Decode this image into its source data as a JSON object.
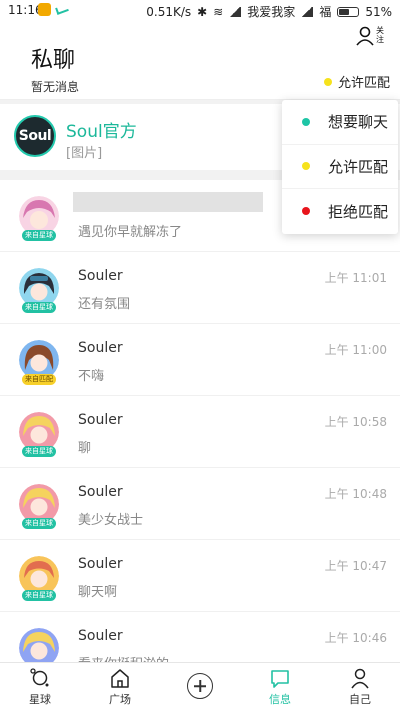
{
  "status_bar": {
    "time": "11:16",
    "speed": "0.51K/s",
    "carrier1": "我爱我家",
    "carrier2": "福",
    "battery": "51%"
  },
  "header": {
    "title": "私聊",
    "subtitle": "暂无消息",
    "follow_label": "关注",
    "match_status": "允许匹配"
  },
  "popup": {
    "items": [
      {
        "label": "想要聊天",
        "color": "#1ec5a6"
      },
      {
        "label": "允许匹配",
        "color": "#f6e21c"
      },
      {
        "label": "拒绝匹配",
        "color": "#e8141c"
      }
    ]
  },
  "official": {
    "logo_text": "Soul",
    "name": "Soul官方",
    "preview": "[图片]"
  },
  "chats": [
    {
      "name": "",
      "preview": "遇见你早就解冻了",
      "time": "",
      "badge": "来自星球",
      "badge_style": "green",
      "face_color": "#f3a7c8",
      "hair_color": "#d877b0"
    },
    {
      "name": "Souler",
      "preview": "还有氛围",
      "time": "上午 11:01",
      "badge": "来自星球",
      "badge_style": "green",
      "face_color": "#8fd6ee",
      "hair_color": "#2a2f3a"
    },
    {
      "name": "Souler",
      "preview": "不嗨",
      "time": "上午 11:00",
      "badge": "来自匹配",
      "badge_style": "yellow",
      "face_color": "#7fb6ef",
      "hair_color": "#8a4a2b"
    },
    {
      "name": "Souler",
      "preview": "聊",
      "time": "上午 10:58",
      "badge": "来自星球",
      "badge_style": "green",
      "face_color": "#f29aa8",
      "hair_color": "#f5d35e"
    },
    {
      "name": "Souler",
      "preview": "美少女战士",
      "time": "上午 10:48",
      "badge": "来自星球",
      "badge_style": "green",
      "face_color": "#f29aa8",
      "hair_color": "#f5d35e"
    },
    {
      "name": "Souler",
      "preview": "聊天啊",
      "time": "上午 10:47",
      "badge": "来自星球",
      "badge_style": "green",
      "face_color": "#f8c45a",
      "hair_color": "#e26d4f"
    },
    {
      "name": "Souler",
      "preview": "看来你挺积淤的",
      "time": "上午 10:46",
      "badge": "",
      "badge_style": "green",
      "face_color": "#8fa4f3",
      "hair_color": "#f5d35e"
    }
  ],
  "bottom_nav": [
    {
      "label": "星球",
      "icon": "planet-icon"
    },
    {
      "label": "广场",
      "icon": "home-icon"
    },
    {
      "label": "",
      "icon": "plus-circle-icon"
    },
    {
      "label": "信息",
      "icon": "message-icon"
    },
    {
      "label": "自己",
      "icon": "person-icon"
    }
  ]
}
